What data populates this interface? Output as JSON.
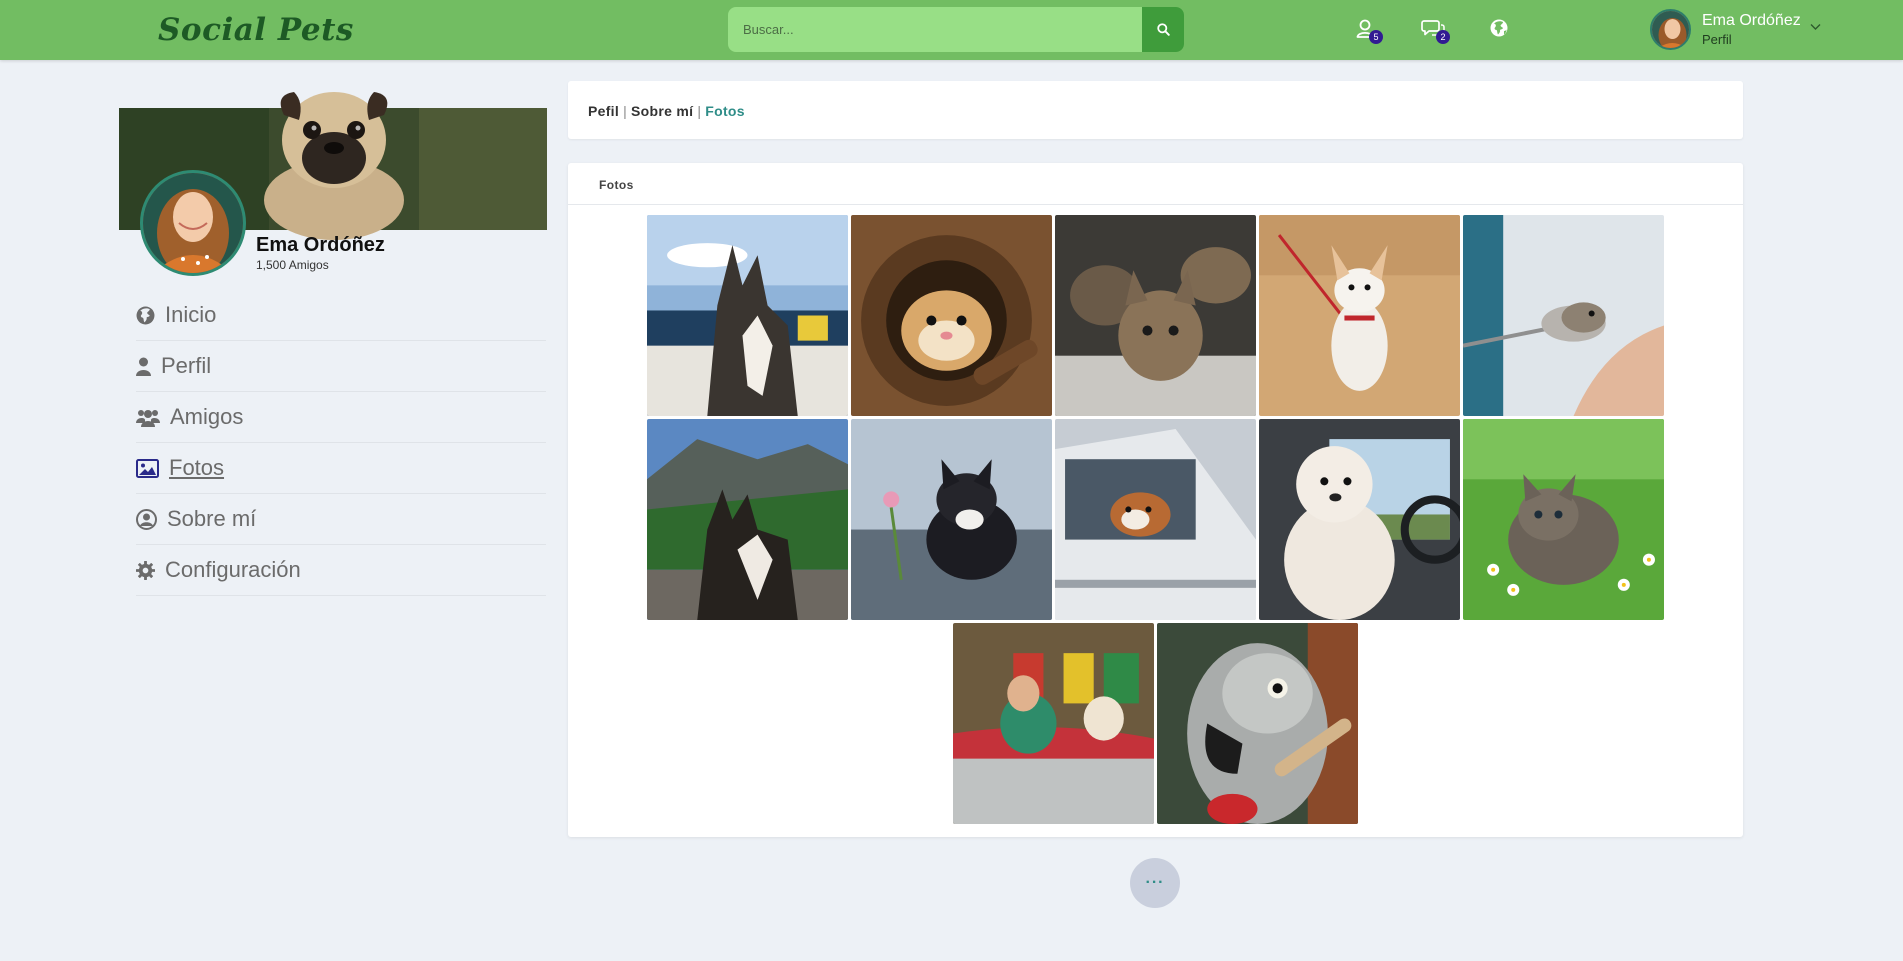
{
  "colors": {
    "nav_bg": "#72bd62",
    "search_bg": "#98df86",
    "search_btn": "#3f9c3b",
    "badge": "#311b92",
    "accent_teal": "#2f8d88",
    "page_bg": "#edf1f6"
  },
  "navbar": {
    "logo": "Social Pets",
    "search": {
      "placeholder": "Buscar...",
      "value": "",
      "button_icon": "search-icon"
    },
    "icons": [
      {
        "icon": "user-icon",
        "badge": "5"
      },
      {
        "icon": "chat-icon",
        "badge": "2"
      },
      {
        "icon": "globe-icon"
      }
    ],
    "user": {
      "name": "Ema Ordóñez",
      "subtitle": "Perfil"
    }
  },
  "profile": {
    "name": "Ema Ordóñez",
    "friends": "1,500 Amigos",
    "menu": [
      {
        "label": "Inicio",
        "icon": "globe-icon"
      },
      {
        "label": "Perfil",
        "icon": "user-icon"
      },
      {
        "label": "Amigos",
        "icon": "users-icon"
      },
      {
        "label": "Fotos",
        "icon": "image-icon",
        "active": true
      },
      {
        "label": "Sobre mí",
        "icon": "user-circle-icon"
      },
      {
        "label": "Configuración",
        "icon": "gear-icon"
      }
    ]
  },
  "breadcrumb": {
    "items": [
      "Pefil",
      "Sobre mí",
      "Fotos"
    ],
    "separator": "|"
  },
  "photos": {
    "title": "Fotos",
    "items": [
      {
        "subject": "husky-on-boat"
      },
      {
        "subject": "hamster-in-coconut"
      },
      {
        "subject": "kittens"
      },
      {
        "subject": "small-dog-on-sand"
      },
      {
        "subject": "hamster-on-spoon"
      },
      {
        "subject": "husky-mountains"
      },
      {
        "subject": "kitten-with-flower"
      },
      {
        "subject": "bulldog-in-car"
      },
      {
        "subject": "poodle-in-car"
      },
      {
        "subject": "kitten-in-grass"
      },
      {
        "subject": "woman-and-dog-in-car"
      },
      {
        "subject": "grey-parrot"
      }
    ]
  },
  "more_button": {
    "label": "···"
  }
}
